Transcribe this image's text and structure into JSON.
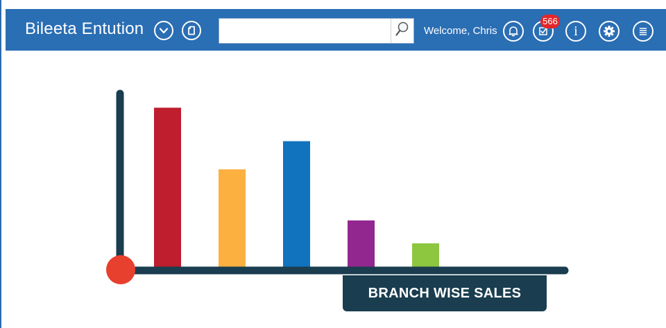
{
  "header": {
    "app_title": "Bileeta Entution",
    "search": {
      "value": "",
      "placeholder": ""
    },
    "welcome_text": "Welcome, Chris",
    "tasks_badge": "566"
  },
  "colors": {
    "header_bg": "#2a6eb4",
    "axis": "#1a3d4f",
    "origin_dot": "#e8402e"
  },
  "icons": [
    "chevron-down-icon",
    "document-icon",
    "search-icon",
    "bell-icon",
    "tasks-check-icon",
    "info-icon",
    "settings-icon",
    "menu-icon"
  ],
  "chart_data": {
    "type": "bar",
    "title": "BRANCH WISE SALES",
    "categories": [
      "",
      "",
      "",
      "",
      ""
    ],
    "values": [
      92,
      57,
      73,
      28,
      15
    ],
    "colors": [
      "#be1e2d",
      "#fbb040",
      "#1173be",
      "#92278f",
      "#8dc63f"
    ],
    "ylim": [
      0,
      100
    ],
    "grid": false,
    "xlabel": "",
    "ylabel": ""
  }
}
